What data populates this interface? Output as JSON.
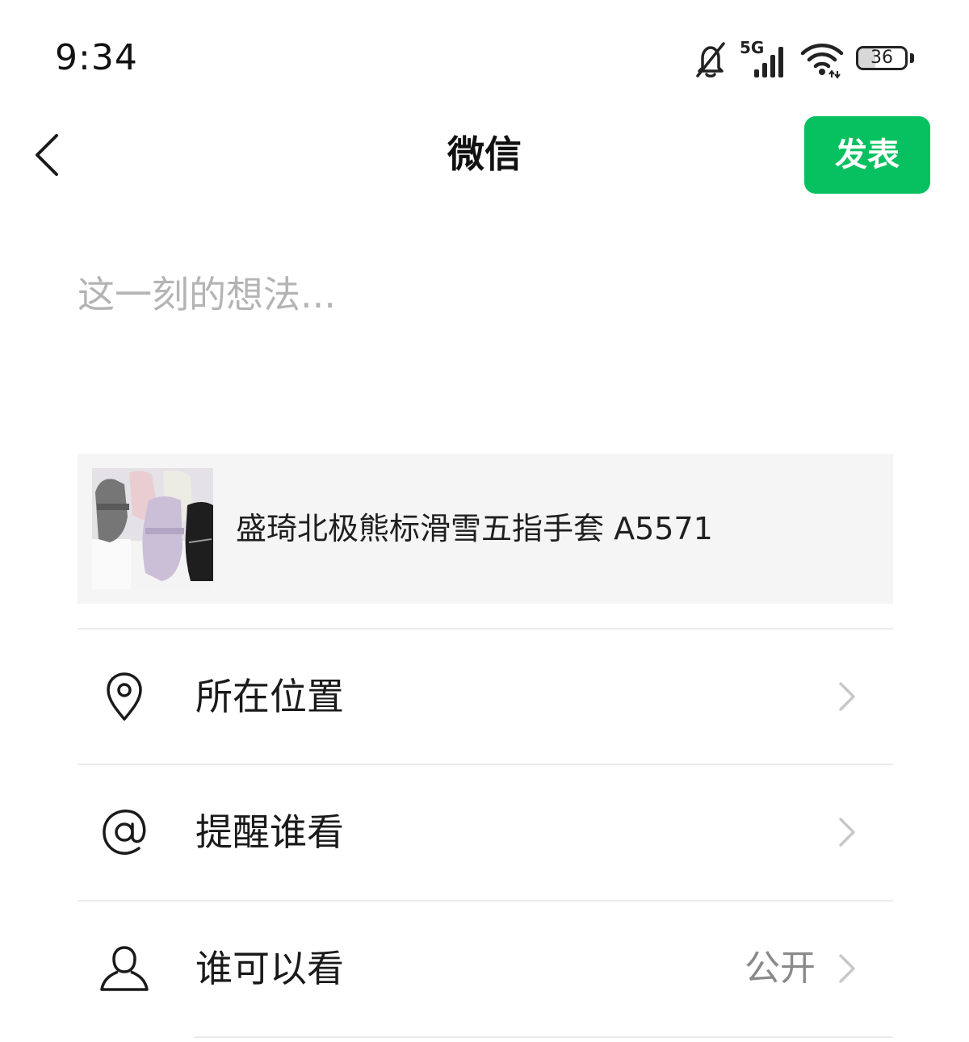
{
  "status_bar": {
    "time": "9:34",
    "network": "5G",
    "battery": "36",
    "battery_level": 0.36,
    "icons": [
      "bell-muted-icon",
      "signal-icon",
      "wifi-icon",
      "battery-icon"
    ]
  },
  "header": {
    "title": "微信",
    "publish_label": "发表",
    "back_icon": "chevron-left-icon"
  },
  "compose": {
    "placeholder": "这一刻的想法...",
    "value": ""
  },
  "link_card": {
    "title": "盛琦北极熊标滑雪五指手套 A5571",
    "thumbnail": "product-photo-gloves"
  },
  "options": [
    {
      "label": "所在位置",
      "value": "",
      "icon": "location-pin-icon"
    },
    {
      "label": "提醒谁看",
      "value": "",
      "icon": "at-sign-icon"
    },
    {
      "label": "谁可以看",
      "value": "公开",
      "icon": "person-icon"
    }
  ],
  "colors": {
    "accent": "#07c160",
    "placeholder": "#b4b4b4",
    "card_background": "#f5f5f5",
    "divider": "#ececec",
    "secondary_text": "#8a8a8a"
  }
}
